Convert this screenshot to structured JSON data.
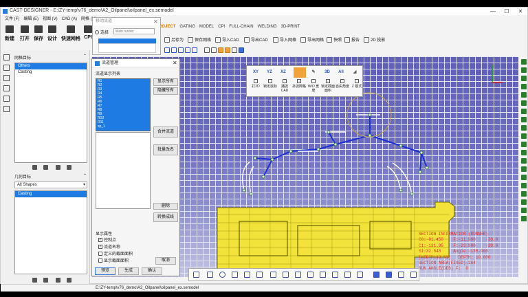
{
  "app": {
    "title": "CAST-DESIGNER - E:\\ZY-temp\\v76_demo\\A2_Oilpanel\\oilpanel_ex.semodel",
    "window_controls": [
      "—",
      "☐",
      "✕"
    ]
  },
  "menu": [
    "文件 (F)",
    "编辑 (E)",
    "视图 (V)",
    "CAD (A)",
    "网格 (M)"
  ],
  "module_tabs": {
    "items": [
      "PROJECT",
      "GATING",
      "MODEL",
      "CPI",
      "FULL-CHAIN",
      "WELDING",
      "3D-PRINT"
    ],
    "active": "PROJECT"
  },
  "big_tools": [
    "新建",
    "打开",
    "保存",
    "设计",
    "快速网格",
    "CPI"
  ],
  "small_tools": [
    "另存为",
    "保存网格",
    "导入CAD",
    "导出CAD",
    "导入网格",
    "导出网格",
    "快照",
    "报告",
    "2D 投影"
  ],
  "left_panel": {
    "mesh_title": "网格目标",
    "mesh_items": [
      {
        "label": "Others",
        "selected": true
      },
      {
        "label": "Casting",
        "selected": false
      }
    ],
    "geo_title": "几何目标",
    "geo_filter": "All Shapes",
    "geo_items": [
      {
        "label": "Casting",
        "selected": true
      }
    ]
  },
  "small_dialog": {
    "title": "移动流道",
    "radio_label": "选择",
    "input_placeholder": "Main runner"
  },
  "runner_dialog": {
    "title": "流道管理",
    "list_label": "流道显示列表",
    "items": [
      "R1",
      "R2",
      "R3",
      "R4",
      "R5",
      "R6",
      "R7",
      "R8",
      "R9",
      "R10",
      "R11",
      "sp_1"
    ],
    "buttons": {
      "show_all": "显示所有",
      "hide_all": "隐藏所有",
      "merge": "合并流道",
      "rename": "批量改名",
      "delete": "删除",
      "convert": "转换成线"
    },
    "props_title": "显示属性",
    "checks": [
      {
        "label": "控制点",
        "checked": true
      },
      {
        "label": "流道名称",
        "checked": true
      },
      {
        "label": "定义的截面面积",
        "checked": false
      },
      {
        "label": "显示截面面积",
        "checked": false
      }
    ],
    "cancel": "取消",
    "preview": "预览",
    "generate": "生成",
    "ok": "确认"
  },
  "view_popup": {
    "view_buttons": [
      "XY",
      "YZ",
      "XZ"
    ],
    "options": [
      "打2D",
      "锁定鼠标",
      "捕捉CAD",
      "扑捉网格",
      "W/O 宽度",
      "锁定截面面积",
      "自由角度",
      "Z 模式"
    ]
  },
  "section_info": [
    "SECTION INFORMATION (RUNNER)",
    "C0:-81.450    F:-11.900    -20.0",
    "C1:-131.95    F:-23.900    -20.0",
    "S1:32.543     Angle:-135.000",
    "[WIDTH:13.61]   DEPTH: 10.000",
    "SECTION AREA(FIXED):164",
    "RUN ANGLE(DEG) F:  0"
  ],
  "statusbar": "E:\\ZY-temp\\v76_demo\\A2_Oilpanel\\oilpanel_ex.semodel",
  "colors": {
    "accent": "#d97900",
    "selection": "#1e7be3",
    "casting": "#f2e23a",
    "runner": "#1c2fd6",
    "section_text": "#e0302a"
  }
}
